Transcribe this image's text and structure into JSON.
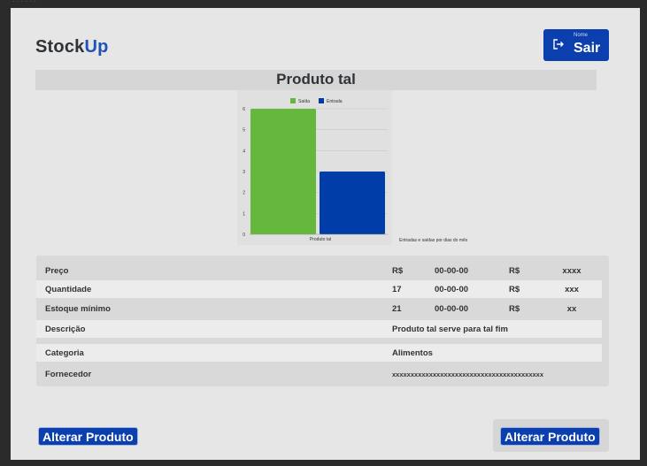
{
  "top_strip_text": "· · ·  ·  ·  ·",
  "logo": {
    "part1": "Stock",
    "part2": "Up"
  },
  "exit_button": {
    "small_label": "Nome",
    "label": "Sair",
    "icon": "logout-icon"
  },
  "product_title": "Produto tal",
  "chart_caption": "Entradas e saídas por dias do mês",
  "chart_data": {
    "type": "bar",
    "categories": [
      "Produto tal"
    ],
    "series": [
      {
        "name": "Saída",
        "values": [
          6
        ],
        "color": "#65b83b"
      },
      {
        "name": "Entrada",
        "values": [
          3
        ],
        "color": "#003da8"
      }
    ],
    "ylim": [
      0,
      6
    ],
    "yticks": [
      "0",
      "1",
      "2",
      "3",
      "4",
      "5",
      "6"
    ],
    "legend_position": "top",
    "grid": true
  },
  "table": {
    "rows": [
      {
        "label": "Preço",
        "currency": "R$",
        "date": "00-00-00",
        "currency2": "R$",
        "value": "xxxx"
      },
      {
        "label": "Quantidade",
        "currency": "17",
        "date": "00-00-00",
        "currency2": "R$",
        "value": "xxx"
      },
      {
        "label": "Estoque mínimo",
        "currency": "21",
        "date": "00-00-00",
        "currency2": "R$",
        "value": "xx"
      },
      {
        "label": "Descrição",
        "text": "Produto tal serve para tal fim"
      },
      {
        "label": "Categoria",
        "text": "Alimentos"
      },
      {
        "label": "Fornecedor",
        "text": "xxxxxxxxxxxxxxxxxxxxxxxxxxxxxxxxxxxxxxxxx"
      }
    ]
  },
  "buttons": {
    "alter_left": "Alterar Produto",
    "alter_right": "Alterar Produto"
  },
  "colors": {
    "brand_blue": "#0c3fae",
    "accent_up": "#1f54b5",
    "green": "#65b83b",
    "dark_blue": "#003da8"
  }
}
